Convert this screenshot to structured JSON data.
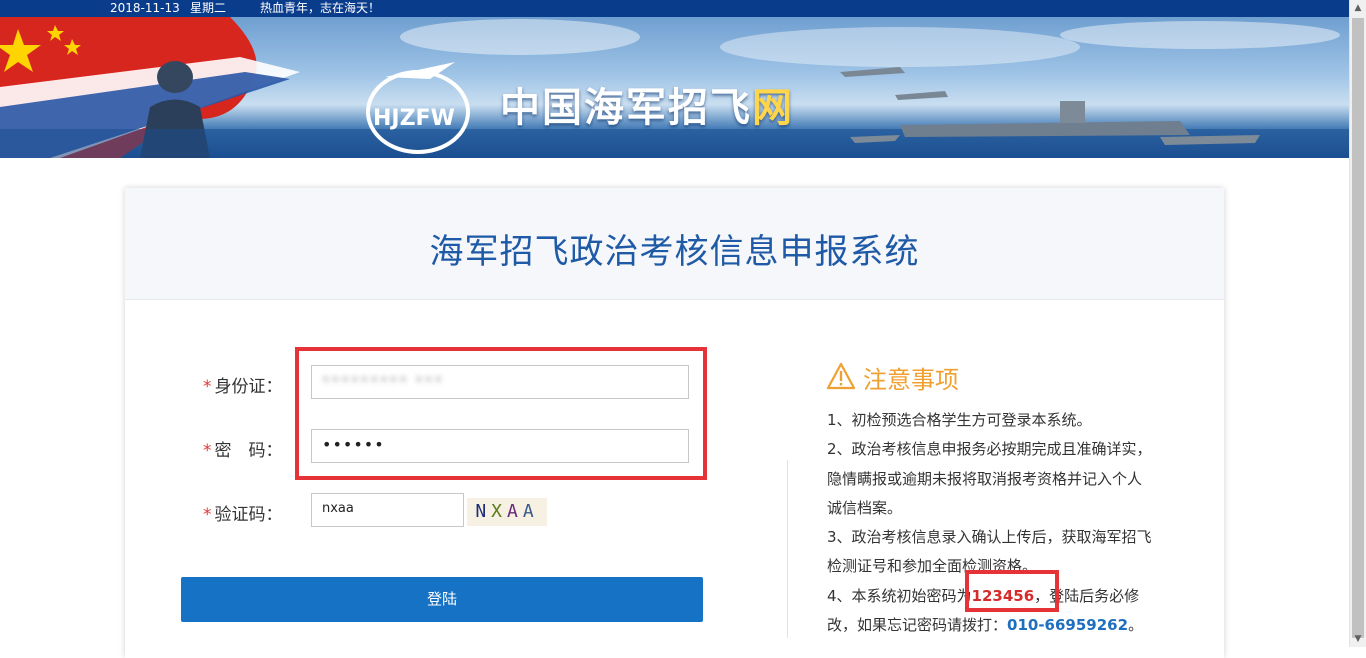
{
  "topbar": {
    "date": "2018-11-13",
    "weekday": "星期二",
    "slogan": "热血青年，志在海天！"
  },
  "banner": {
    "logo_text_main": "中国海军招飞",
    "logo_text_highlight": "网",
    "logo_emblem": "HJZFW"
  },
  "card": {
    "title": "海军招飞政治考核信息申报系统"
  },
  "form": {
    "required_mark": "*",
    "id_label": "身份证：",
    "id_value": "••••••••• •••",
    "password_label": "密　码：",
    "password_value": "••••••",
    "captcha_label": "验证码：",
    "captcha_value": "nxaa",
    "captcha_chars": [
      "N",
      "X",
      "A",
      "A"
    ],
    "login_label": "登陆"
  },
  "notice": {
    "title": "注意事项",
    "line1": "1、初检预选合格学生方可登录本系统。",
    "line2": "2、政治考核信息申报务必按期完成且准确详实，",
    "line3": "隐情瞒报或逾期未报将取消报考资格并记入个人",
    "line4": "诚信档案。",
    "line5": "3、政治考核信息录入确认上传后，获取海军招飞",
    "line6": "检测证号和参加全面检测资格。",
    "line7_prefix": "4、本系统初始密码为",
    "line7_password": "123456",
    "line7_suffix": "，登陆后务必修",
    "line8_prefix": "改，如果忘记密码请拨打：",
    "line8_phone": "010-66959262",
    "line8_suffix": "。"
  },
  "colors": {
    "accent_blue": "#1672c4",
    "title_blue": "#1f5aa6",
    "highlight_red": "#e53338",
    "notice_orange": "#f0a030"
  }
}
